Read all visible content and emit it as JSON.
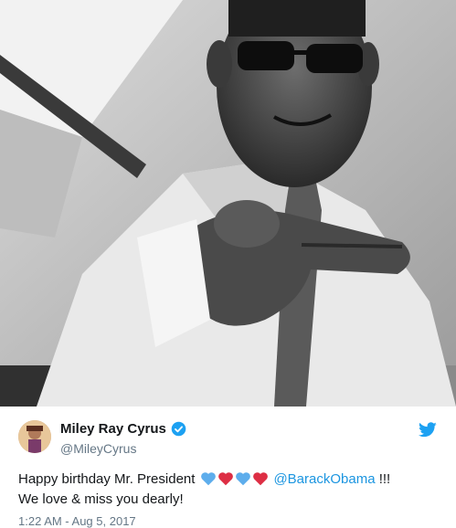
{
  "photo": {
    "description_icon": "portrait-photo"
  },
  "tweet": {
    "display_name": "Miley Ray Cyrus",
    "handle": "@MileyCyrus",
    "text_before": "Happy birthday Mr. President",
    "hearts": [
      "blue-heart",
      "red-heart",
      "blue-heart",
      "red-heart"
    ],
    "mention": "@BarackObama",
    "text_after": " !!!",
    "line2": "We love & miss you dearly!",
    "timestamp": "1:22 AM - Aug 5, 2017"
  },
  "colors": {
    "accent": "#1da1f2",
    "mention": "#1b95e0",
    "blue_heart": "#5dadec",
    "red_heart": "#dd2e44",
    "text": "#14171a",
    "muted": "#657786"
  }
}
